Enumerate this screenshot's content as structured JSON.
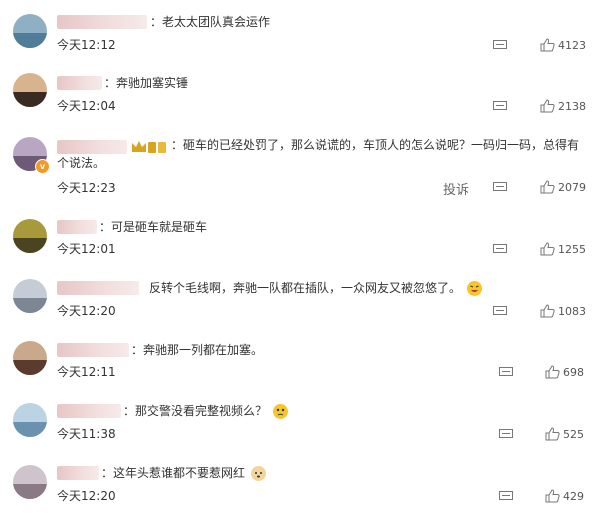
{
  "comments": [
    {
      "text": "：老太太团队真会运作",
      "time": "今天12:12",
      "likes": "4123"
    },
    {
      "text": "：奔驰加塞实锤",
      "time": "今天12:04",
      "likes": "2138"
    },
    {
      "text": "：砸车的已经处罚了，那么说谎的，车顶人的怎么说呢？一码归一码，总得有个说法。",
      "time": "今天12:23",
      "likes": "2079",
      "report": "投诉"
    },
    {
      "text": "：可是砸车就是砸车",
      "time": "今天12:01",
      "likes": "1255"
    },
    {
      "text": "反转个毛线啊，奔驰一队都在插队，一众网友又被忽悠了。",
      "time": "今天12:20",
      "likes": "1083"
    },
    {
      "text": "：奔驰那一列都在加塞。",
      "time": "今天12:11",
      "likes": "698"
    },
    {
      "text": "：那交警没看完整视频么？",
      "time": "今天11:38",
      "likes": "525"
    },
    {
      "text": "：这年头惹谁都不要惹网红",
      "time": "今天12:20",
      "likes": "429"
    }
  ],
  "colors": {
    "text": "#333333",
    "icon": "#777777",
    "verify_badge": "#f09a2a",
    "crown": "#d9a520"
  },
  "icons": {
    "reply": "comment-bubble-icon",
    "like": "thumbs-up-icon",
    "verified": "verified-badge-icon",
    "member": "crown-member-icon",
    "emoji_laugh": "laugh-emoji-icon",
    "emoji_think": "thinking-emoji-icon",
    "emoji_dog": "doge-emoji-icon"
  }
}
